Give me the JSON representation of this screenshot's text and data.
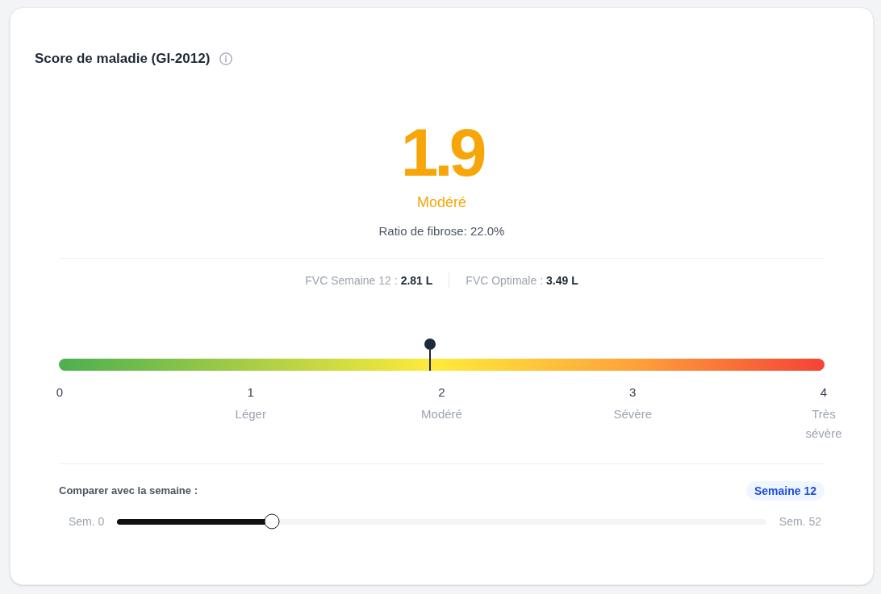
{
  "card": {
    "title": "Score de maladie (GI-2012)"
  },
  "score": {
    "value": "1.9",
    "category": "Modéré",
    "ratio": "Ratio de fibrose: 22.0%"
  },
  "fvc": [
    {
      "label": "FVC Semaine 12 :",
      "value": "2.81 L"
    },
    {
      "label": "FVC Optimale :",
      "value": "3.49 L"
    }
  ],
  "gauge": {
    "level": 0.485,
    "ticks": [
      {
        "number": "0"
      },
      {
        "number": "1",
        "label": "Léger"
      },
      {
        "number": "2",
        "label": "Modéré"
      },
      {
        "number": "3",
        "label": "Sévère"
      },
      {
        "number": "4",
        "label": "Très sévère"
      }
    ]
  },
  "compare": {
    "label": "Comparer avec la semaine :",
    "badge": "Semaine 12",
    "min_label": "Sem. 0",
    "max_label": "Sem. 52",
    "level": 0.238
  }
}
